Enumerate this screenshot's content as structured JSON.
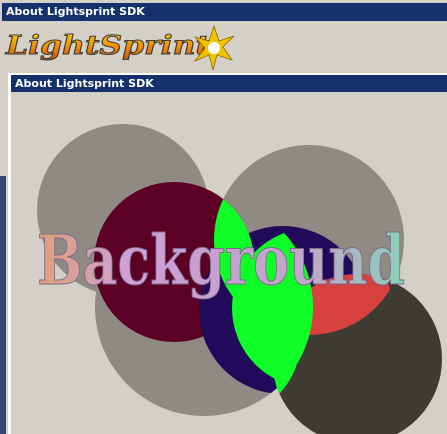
{
  "window": {
    "title": "About Lightsprint SDK"
  },
  "logo": {
    "text": "LightSprint"
  },
  "inner_window": {
    "title": "About Lightsprint SDK"
  },
  "scene": {
    "background_text": "Background"
  },
  "colors": {
    "titlebar": "#14316b",
    "face": "#d4d0c8",
    "gray_circle": "#8f8a83",
    "dark_red": "#5c0026",
    "green": "#0dff27",
    "dark_green": "#0d5a26",
    "navy": "#220a5a",
    "red": "#d8423e",
    "dark_gray": "#403a35"
  }
}
